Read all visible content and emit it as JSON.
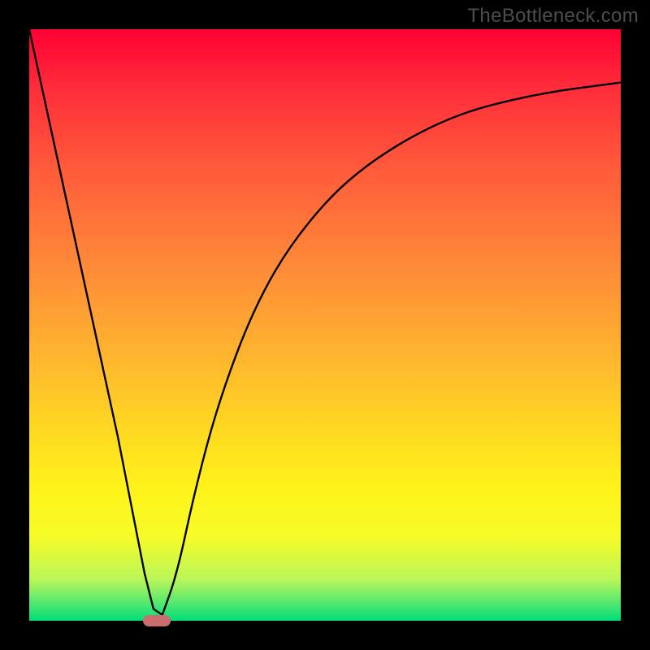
{
  "watermark": "TheBottleneck.com",
  "chart_data": {
    "type": "line",
    "title": "",
    "xlabel": "",
    "ylabel": "",
    "xlim": [
      0,
      1
    ],
    "ylim": [
      0,
      1
    ],
    "series": [
      {
        "name": "bottleneck-curve",
        "x": [
          0.0,
          0.05,
          0.1,
          0.15,
          0.195,
          0.21,
          0.225,
          0.25,
          0.28,
          0.32,
          0.38,
          0.45,
          0.55,
          0.7,
          0.85,
          1.0
        ],
        "y": [
          1.0,
          0.77,
          0.54,
          0.31,
          0.08,
          0.02,
          0.01,
          0.08,
          0.22,
          0.37,
          0.53,
          0.65,
          0.76,
          0.85,
          0.89,
          0.91
        ]
      }
    ],
    "marker": {
      "x": 0.215,
      "y": 0.0,
      "color": "#cb6d6f"
    },
    "background_gradient": {
      "top": "#ff0033",
      "mid": "#ffd400",
      "bottom": "#00dd77"
    }
  }
}
